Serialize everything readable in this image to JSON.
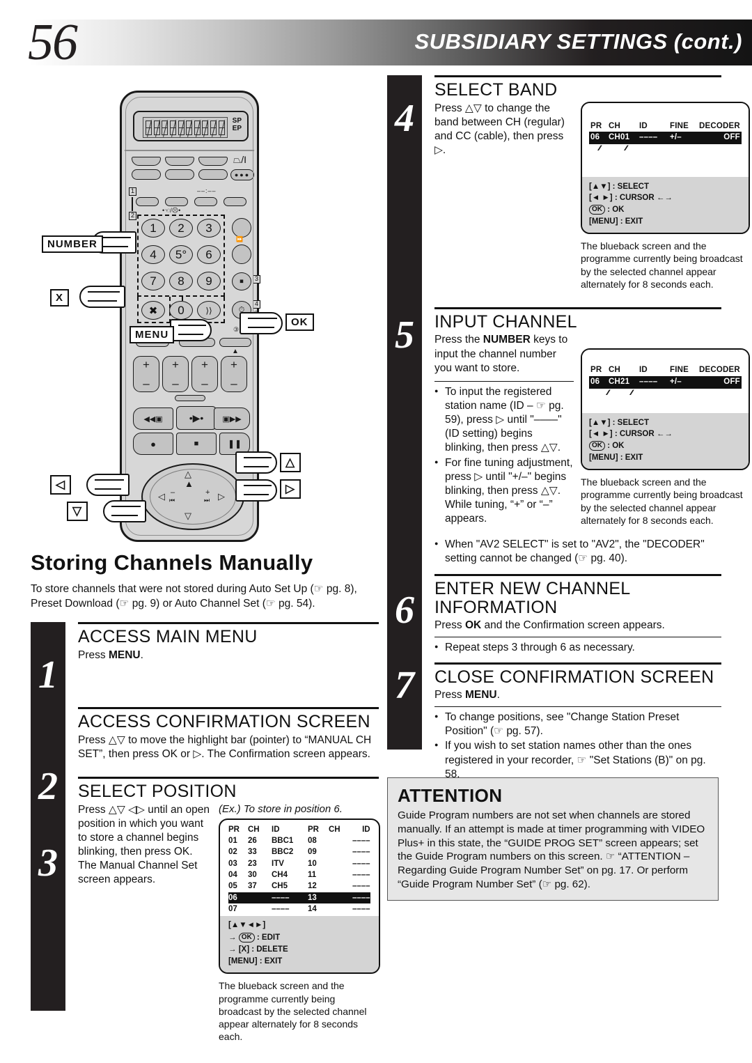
{
  "header": {
    "page_number": "56",
    "title": "SUBSIDIARY SETTINGS (cont.)"
  },
  "remote": {
    "display_sp": "SP",
    "display_ep": "EP",
    "number_keys": [
      "1",
      "2",
      "3",
      "4",
      "5°",
      "6",
      "7",
      "8",
      "9",
      "0"
    ],
    "callouts": {
      "number": "NUMBER",
      "cancel": "X",
      "menu": "MENU",
      "ok": "OK",
      "up": "△",
      "down": "▽",
      "left": "◁",
      "right": "▷"
    },
    "power_icon": "power-icon",
    "markers": [
      "1",
      "2",
      "3",
      "4"
    ]
  },
  "left_section": {
    "heading": "Storing Channels Manually",
    "intro": "To store channels that were not stored during Auto Set Up (☞ pg. 8), Preset Download (☞ pg. 9) or Auto Channel Set (☞ pg. 54).",
    "steps": [
      {
        "number": "1",
        "title": "ACCESS MAIN MENU",
        "body_pre": "Press ",
        "body_bold": "MENU",
        "body_post": "."
      },
      {
        "number": "2",
        "title": "ACCESS CONFIRMATION SCREEN",
        "body": "Press △▽ to move the highlight bar (pointer) to “MANUAL CH SET”, then press OK or ▷. The Confirmation screen appears."
      },
      {
        "number": "3",
        "title": "SELECT POSITION",
        "body": "Press △▽ ◁▷ until an open position in which you want to store a channel begins blinking, then press OK. The Manual Channel Set screen appears.",
        "example_label": "(Ex.) To store in position 6.",
        "caption": "The blueback screen and the programme currently being broadcast by the selected channel appear alternately for 8 seconds each."
      }
    ]
  },
  "channel_list_osd": {
    "headers_left": [
      "PR",
      "CH",
      "ID"
    ],
    "headers_right": [
      "PR",
      "CH",
      "ID"
    ],
    "rows": [
      {
        "pr": "01",
        "ch": "26",
        "id": "BBC1",
        "pr2": "08",
        "ch2": "",
        "id2": "––––",
        "highlight": false
      },
      {
        "pr": "02",
        "ch": "33",
        "id": "BBC2",
        "pr2": "09",
        "ch2": "",
        "id2": "––––",
        "highlight": false
      },
      {
        "pr": "03",
        "ch": "23",
        "id": "ITV",
        "pr2": "10",
        "ch2": "",
        "id2": "––––",
        "highlight": false
      },
      {
        "pr": "04",
        "ch": "30",
        "id": "CH4",
        "pr2": "11",
        "ch2": "",
        "id2": "––––",
        "highlight": false
      },
      {
        "pr": "05",
        "ch": "37",
        "id": "CH5",
        "pr2": "12",
        "ch2": "",
        "id2": "––––",
        "highlight": false
      },
      {
        "pr": "06",
        "ch": "",
        "id": "––––",
        "pr2": "13",
        "ch2": "",
        "id2": "––––",
        "highlight": true
      },
      {
        "pr": "07",
        "ch": "",
        "id": "––––",
        "pr2": "14",
        "ch2": "",
        "id2": "––––",
        "highlight": false
      }
    ],
    "legend": {
      "keys": "[▲▼◄►]",
      "edit": ": EDIT",
      "edit_key": "OK",
      "delete": "[X] : DELETE",
      "exit": "[MENU] : EXIT",
      "arrow": "→"
    }
  },
  "right_steps": [
    {
      "number": "4",
      "title": "SELECT BAND",
      "body": "Press △▽ to change the band between CH (regular) and CC (cable), then press ▷.",
      "caption": "The blueback screen and the programme currently being broadcast by the selected channel appear alternately for 8 seconds each."
    },
    {
      "number": "5",
      "title": "INPUT CHANNEL",
      "body_pre": "Press the ",
      "body_bold": "NUMBER",
      "body_post": " keys to input the channel number you want to store.",
      "bullets": [
        "To input the registered station name (ID – ☞ pg. 59), press ▷ until \"––––\" (ID setting) begins blinking, then press △▽.",
        "For fine tuning adjustment, press ▷ until \"+/–\" begins blinking, then press △▽. While tuning, “+” or “–” appears.",
        "When \"AV2 SELECT\" is set to \"AV2\", the \"DECODER\" setting cannot be changed (☞ pg. 40)."
      ],
      "caption": "The blueback screen and the programme currently being broadcast by the selected channel appear alternately for 8 seconds each."
    },
    {
      "number": "6",
      "title": "ENTER NEW CHANNEL INFORMATION",
      "body_pre": "Press ",
      "body_bold": "OK",
      "body_post": " and the Confirmation screen appears.",
      "bullets": [
        "Repeat steps 3 through 6 as necessary."
      ]
    },
    {
      "number": "7",
      "title": "CLOSE CONFIRMATION SCREEN",
      "body_pre": "Press ",
      "body_bold": "MENU",
      "body_post": ".",
      "bullets": [
        "To change positions, see \"Change Station Preset Position\" (☞ pg. 57).",
        "If you wish to set station names other than the ones registered in your recorder, ☞ \"Set Stations (B)\" on pg. 58."
      ]
    }
  ],
  "osd_band": {
    "headers": [
      "PR",
      "CH",
      "ID",
      "FINE",
      "DECODER"
    ],
    "row": {
      "pr": "06",
      "ch": "CH01",
      "id": "––––",
      "fine": "+/–",
      "decoder": "OFF"
    },
    "legend": {
      "select": "[▲▼] : SELECT",
      "cursor": "[◄ ►] : CURSOR ←→",
      "ok_key": "OK",
      "ok": ": OK",
      "exit": "[MENU] : EXIT"
    }
  },
  "osd_channel": {
    "headers": [
      "PR",
      "CH",
      "ID",
      "FINE",
      "DECODER"
    ],
    "row": {
      "pr": "06",
      "ch": "CH21",
      "id": "––––",
      "fine": "+/–",
      "decoder": "OFF"
    },
    "legend": {
      "select": "[▲▼] : SELECT",
      "cursor": "[◄ ►] : CURSOR ←→",
      "ok_key": "OK",
      "ok": ": OK",
      "exit": "[MENU] : EXIT"
    }
  },
  "attention": {
    "title": "ATTENTION",
    "body": "Guide Program numbers are not set when channels are stored manually. If an attempt is made at timer programming with VIDEO Plus+ in this state, the “GUIDE PROG SET” screen appears; set the Guide Program numbers on this screen. ☞ “ATTENTION – Regarding Guide Program Number Set” on pg. 17.\nOr perform “Guide Program Number Set” (☞ pg. 62)."
  }
}
